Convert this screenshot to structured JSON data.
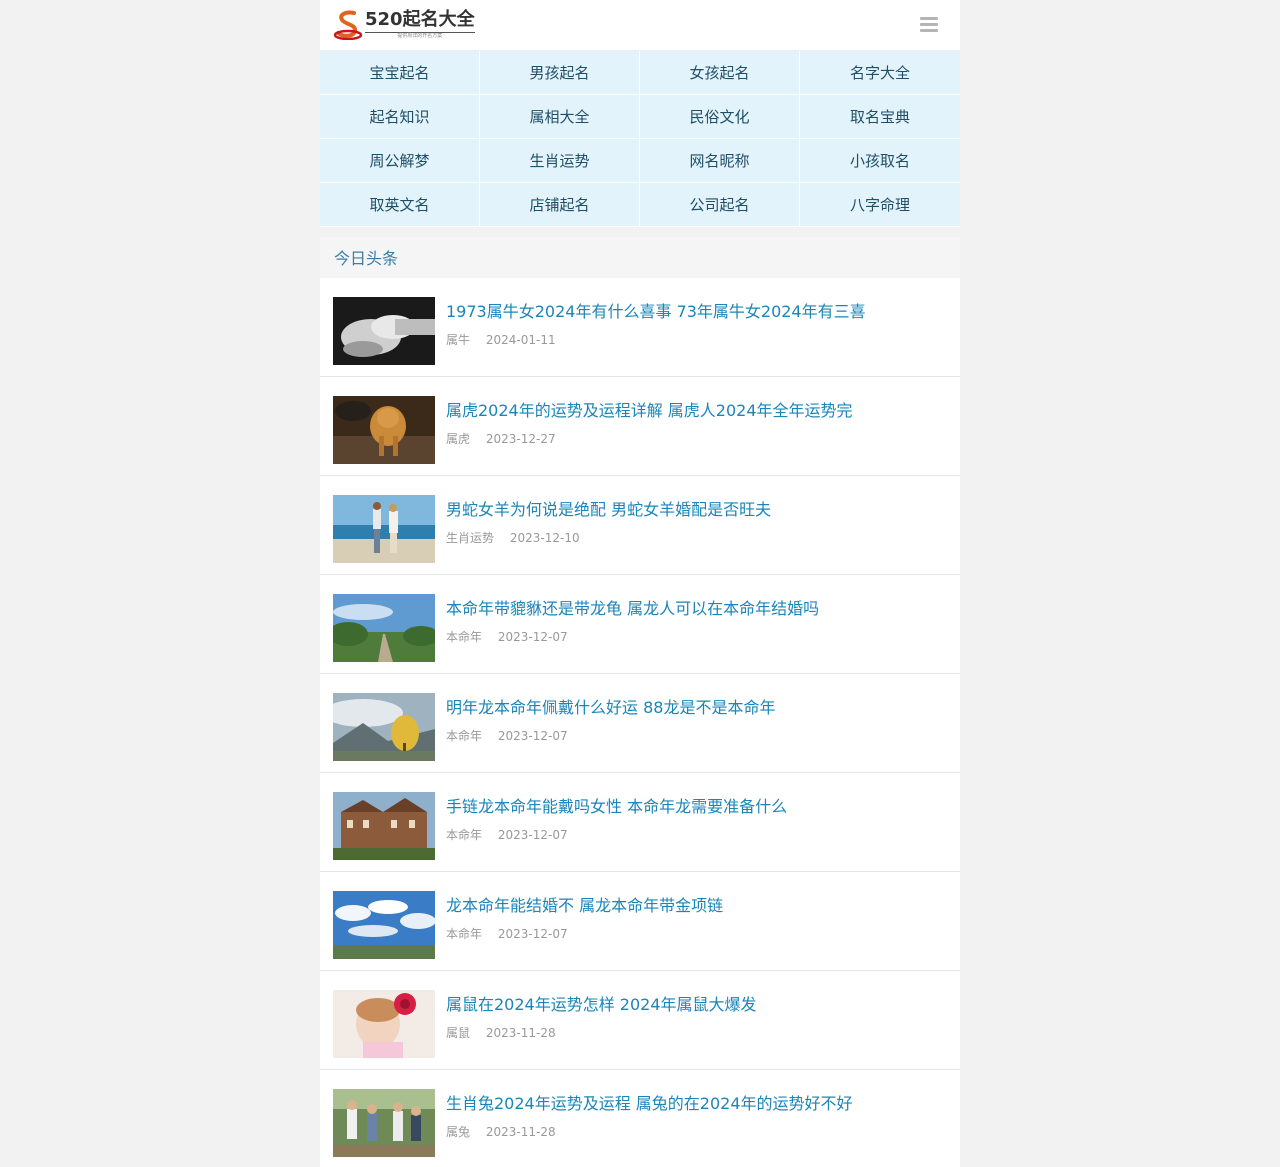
{
  "header": {
    "logo_text": "520起名大全",
    "logo_sub": "提供周详的开名方案",
    "menu_icon": "hamburger-menu-icon"
  },
  "nav": [
    "宝宝起名",
    "男孩起名",
    "女孩起名",
    "名字大全",
    "起名知识",
    "属相大全",
    "民俗文化",
    "取名宝典",
    "周公解梦",
    "生肖运势",
    "网名昵称",
    "小孩取名",
    "取英文名",
    "店铺起名",
    "公司起名",
    "八字命理"
  ],
  "section": {
    "title": "今日头条"
  },
  "articles": [
    {
      "title": "1973属牛女2024年有什么喜事 73年属牛女2024年有三喜",
      "category": "属牛",
      "date": "2024-01-11",
      "thumb": "hands-photo"
    },
    {
      "title": "属虎2024年的运势及运程详解 属虎人2024年全年运势完",
      "category": "属虎",
      "date": "2023-12-27",
      "thumb": "tiger-photo"
    },
    {
      "title": "男蛇女羊为何说是绝配 男蛇女羊婚配是否旺夫",
      "category": "生肖运势",
      "date": "2023-12-10",
      "thumb": "beach-couple-photo"
    },
    {
      "title": "本命年带貔貅还是带龙龟 属龙人可以在本命年结婚吗",
      "category": "本命年",
      "date": "2023-12-07",
      "thumb": "country-road-photo"
    },
    {
      "title": "明年龙本命年佩戴什么好运 88龙是不是本命年",
      "category": "本命年",
      "date": "2023-12-07",
      "thumb": "autumn-tree-photo"
    },
    {
      "title": "手链龙本命年能戴吗女性 本命年龙需要准备什么",
      "category": "本命年",
      "date": "2023-12-07",
      "thumb": "mansion-photo"
    },
    {
      "title": "龙本命年能结婚不 属龙本命年带金项链",
      "category": "本命年",
      "date": "2023-12-07",
      "thumb": "sky-clouds-photo"
    },
    {
      "title": "属鼠在2024年运势怎样 2024年属鼠大爆发",
      "category": "属鼠",
      "date": "2023-11-28",
      "thumb": "girl-flower-photo"
    },
    {
      "title": "生肖兔2024年运势及运程 属兔的在2024年的运势好不好",
      "category": "属兔",
      "date": "2023-11-28",
      "thumb": "family-photo"
    }
  ]
}
